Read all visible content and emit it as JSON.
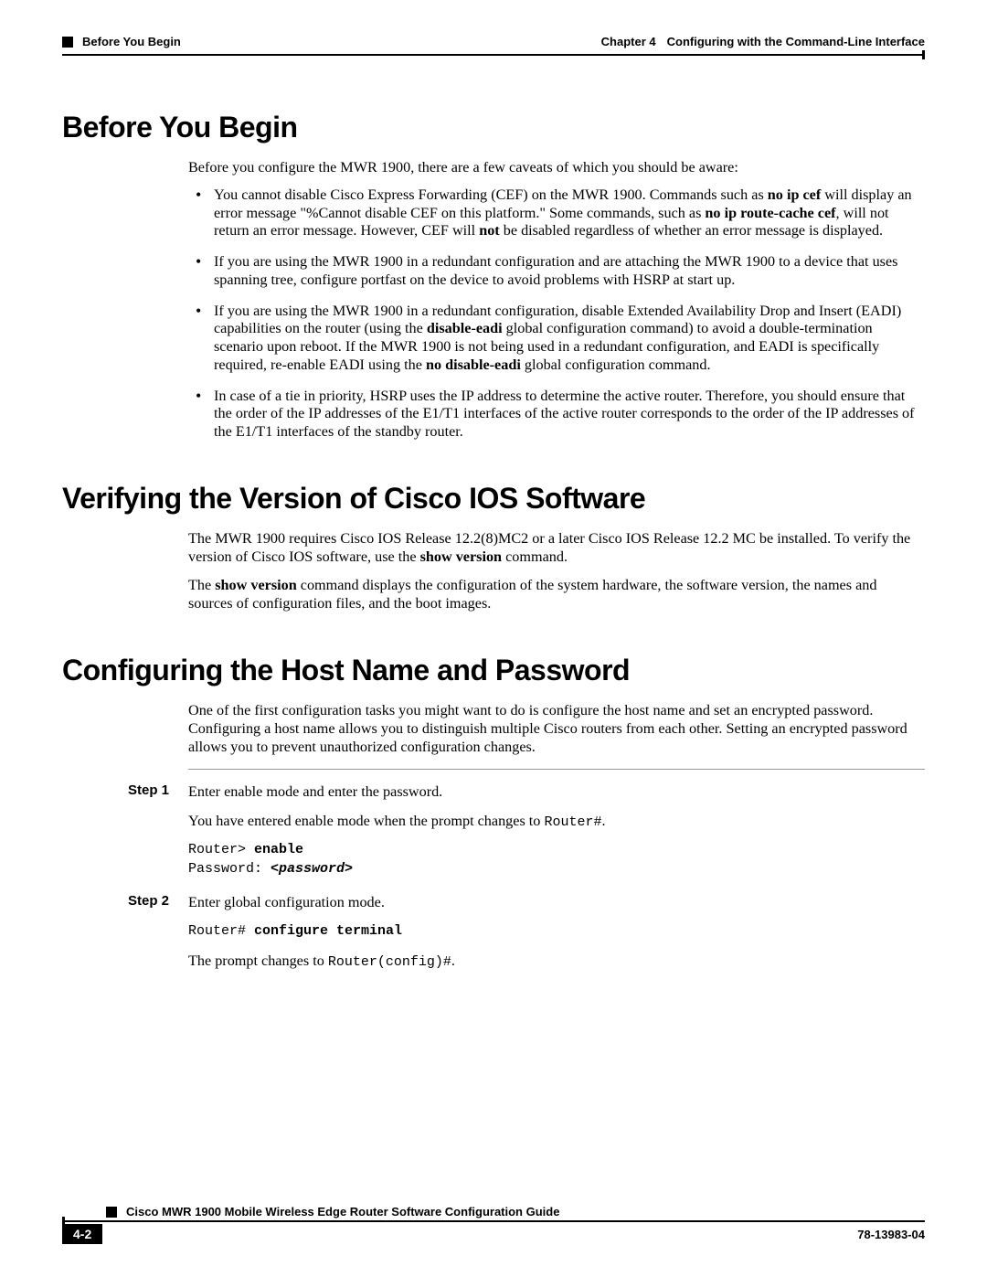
{
  "header": {
    "chapter_label": "Chapter 4",
    "chapter_title": "Configuring with the Command-Line Interface",
    "running_section": "Before You Begin"
  },
  "sections": {
    "s1": {
      "heading": "Before You Begin",
      "intro": "Before you configure the MWR 1900, there are a few caveats of which you should be aware:",
      "bullets": {
        "b1": {
          "pre": "You cannot disable Cisco Express Forwarding (CEF) on the MWR 1900. Commands such as ",
          "cmd1": "no ip cef",
          "mid1": " will display an error message \"%Cannot disable CEF on this platform.\" Some commands, such as ",
          "cmd2": "no ip route-cache cef",
          "mid2": ", will not return an error message. However, CEF will ",
          "not": "not",
          "post": " be disabled regardless of whether an error message is displayed."
        },
        "b2": "If you are using the MWR 1900 in a redundant configuration and are attaching the MWR 1900 to a device that uses spanning tree, configure portfast on the device to avoid problems with HSRP at start up.",
        "b3": {
          "pre": "If you are using the MWR 1900 in a redundant configuration, disable Extended Availability Drop and Insert (EADI) capabilities on the router (using the ",
          "cmd1": "disable-eadi",
          "mid1": " global configuration command) to avoid a double-termination scenario upon reboot. If the MWR 1900 is not being used in a redundant configuration, and EADI is specifically required, re-enable EADI using the ",
          "cmd2": "no disable-eadi",
          "post": " global configuration command."
        },
        "b4": "In case of a tie in priority, HSRP uses the IP address to determine the active router. Therefore, you should ensure that the order of the IP addresses of the E1/T1 interfaces of the active router corresponds to the order of the IP addresses of the E1/T1 interfaces of the standby router."
      }
    },
    "s2": {
      "heading": "Verifying the Version of Cisco IOS Software",
      "p1": {
        "pre": "The MWR 1900 requires Cisco IOS Release 12.2(8)MC2 or a later Cisco IOS Release 12.2 MC be installed. To verify the version of Cisco IOS software, use the ",
        "cmd": "show version",
        "post": " command."
      },
      "p2": {
        "pre": "The ",
        "cmd": "show version",
        "post": " command displays the configuration of the system hardware, the software version, the names and sources of configuration files, and the boot images."
      }
    },
    "s3": {
      "heading": "Configuring the Host Name and Password",
      "intro": "One of the first configuration tasks you might want to do is configure the host name and set an encrypted password. Configuring a host name allows you to distinguish multiple Cisco routers from each other. Setting an encrypted password allows you to prevent unauthorized configuration changes.",
      "steps": {
        "label1": "Step 1",
        "step1_p1": "Enter enable mode and enter the password.",
        "step1_p2_pre": "You have entered enable mode when the prompt changes to ",
        "step1_prompt": "Router#",
        "step1_p2_post": ".",
        "step1_code_l1_a": "Router> ",
        "step1_code_l1_b": "enable",
        "step1_code_l2_a": "Password: ",
        "step1_code_l2_b": "<password>",
        "label2": "Step 2",
        "step2_p1": "Enter global configuration mode.",
        "step2_code_a": "Router# ",
        "step2_code_b": "configure terminal",
        "step2_p2_pre": "The prompt changes to ",
        "step2_prompt": "Router(config)#",
        "step2_p2_post": "."
      }
    }
  },
  "footer": {
    "guide_title": "Cisco MWR 1900 Mobile Wireless Edge Router Software Configuration Guide",
    "page_number": "4-2",
    "doc_number": "78-13983-04"
  }
}
